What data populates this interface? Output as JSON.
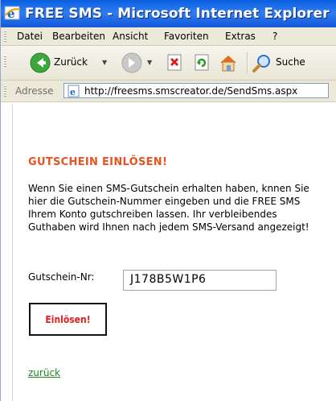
{
  "window": {
    "title": "FREE SMS - Microsoft Internet Explorer"
  },
  "menu": {
    "items": [
      "Datei",
      "Bearbeiten",
      "Ansicht",
      "Favoriten",
      "Extras",
      "?"
    ]
  },
  "toolbar": {
    "back_label": "Zurück",
    "search_label": "Suche"
  },
  "address": {
    "label": "Adresse",
    "url": "http://freesms.smscreator.de/SendSms.aspx"
  },
  "page": {
    "heading": "GUTSCHEIN EINLÖSEN!",
    "paragraph": "Wenn Sie einen SMS-Gutschein erhalten haben, knnen Sie hier die Gutschein-Nummer eingeben und die FREE SMS Ihrem Konto gutschreiben lassen. Ihr verbleibendes Guthaben wird Ihnen nach jedem SMS-Versand angezeigt!",
    "code_label": "Gutschein-Nr:",
    "code_value": "J178B5W1P6",
    "redeem_label": "Einlösen!",
    "back_link": "zurück"
  },
  "colors": {
    "heading": "#e8541e",
    "button_text": "#e0201e",
    "link": "#1c8a1c",
    "titlebar": "#0a5fe0"
  }
}
